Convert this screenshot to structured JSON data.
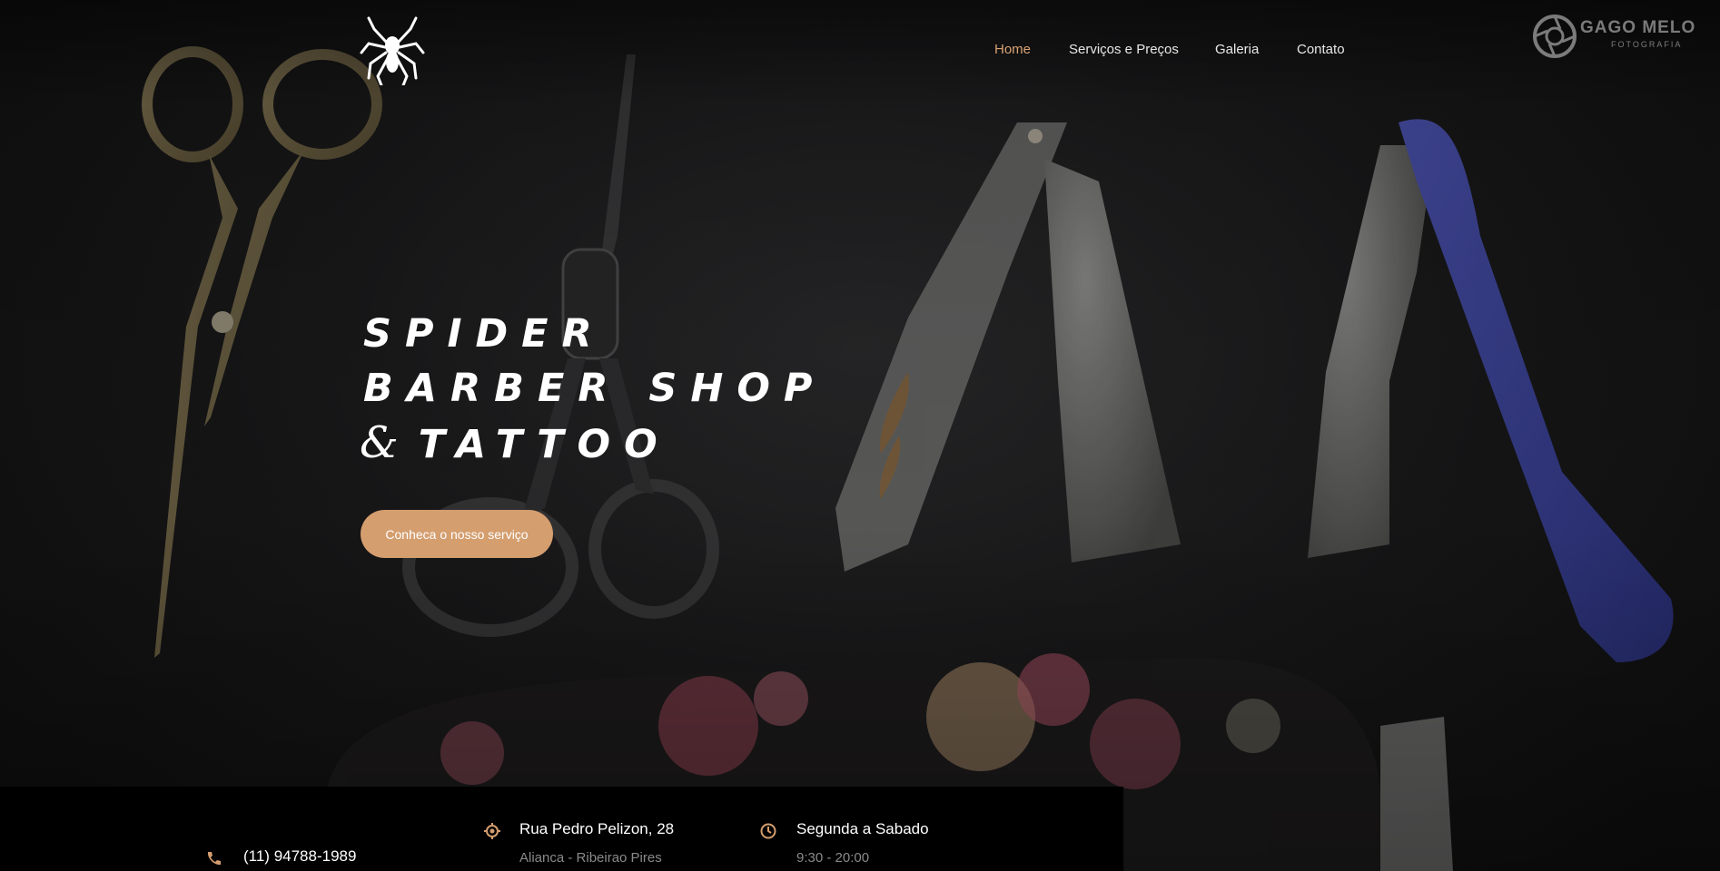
{
  "brand": {
    "logo_icon": "spider-icon",
    "watermark_title": "GAGO MELO",
    "watermark_subtitle": "FOTOGRAFIA",
    "watermark_icon": "camera-aperture-icon"
  },
  "nav": {
    "items": [
      {
        "label": "Home",
        "active": true
      },
      {
        "label": "Serviços e Preços",
        "active": false
      },
      {
        "label": "Galeria",
        "active": false
      },
      {
        "label": "Contato",
        "active": false
      }
    ]
  },
  "hero": {
    "title_line1": "Spider",
    "title_line2": "Barber Shop",
    "title_amp": "&",
    "title_line3": "Tattoo",
    "cta_label": "Conheca o nosso serviço"
  },
  "info": {
    "phone": {
      "icon": "phone-icon",
      "value": "(11) 94788-1989"
    },
    "address": {
      "icon": "location-pin-icon",
      "line1": "Rua Pedro Pelizon, 28",
      "line2": "Alianca - Ribeirao Pires"
    },
    "hours": {
      "icon": "clock-icon",
      "line1": "Segunda a Sabado",
      "line2": "9:30 - 20:00"
    }
  },
  "colors": {
    "accent": "#d49e6f",
    "nav_active": "#d9a272",
    "info_bar": "#000000",
    "text_primary": "#ffffff",
    "text_muted": "#8a8a8a"
  }
}
